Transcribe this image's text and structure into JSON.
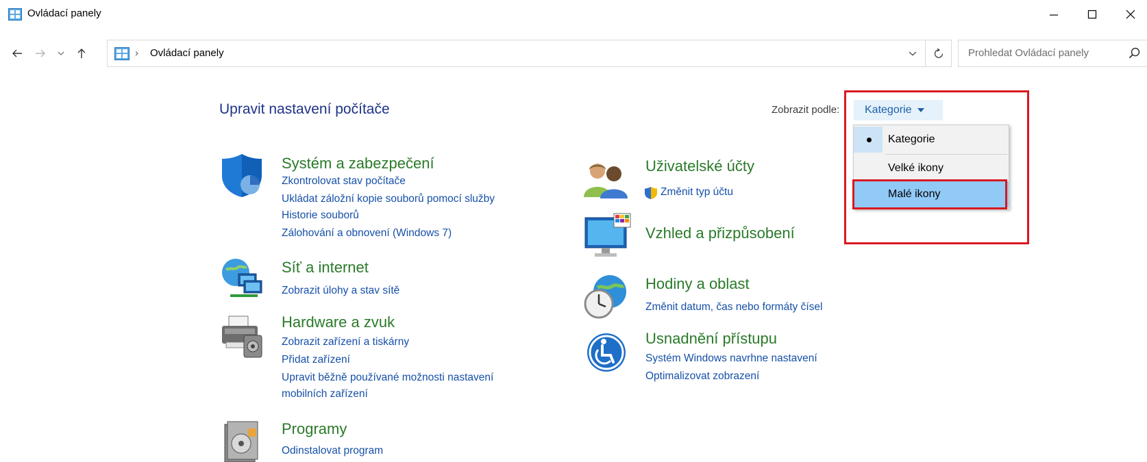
{
  "window": {
    "title": "Ovládací panely",
    "controls": {
      "minimize": "minimize-icon",
      "maximize": "maximize-icon",
      "close": "close-icon"
    }
  },
  "nav": {
    "breadcrumb": "Ovládací panely",
    "search_placeholder": "Prohledat Ovládací panely"
  },
  "main": {
    "heading": "Upravit nastavení počítače",
    "view_by_label": "Zobrazit podle:",
    "view_by_value": "Kategorie",
    "view_by_options": [
      "Kategorie",
      "Velké ikony",
      "Malé ikony"
    ],
    "selected_option": "Kategorie",
    "hovered_option": "Malé ikony"
  },
  "categories_left": [
    {
      "title": "Systém a zabezpečení",
      "icon": "shield-icon",
      "links": [
        "Zkontrolovat stav počítače",
        "Ukládat záložní kopie souborů pomocí služby",
        "Historie souborů",
        "Zálohování a obnovení (Windows 7)"
      ]
    },
    {
      "title": "Síť a internet",
      "icon": "network-icon",
      "links": [
        "Zobrazit úlohy a stav sítě"
      ]
    },
    {
      "title": "Hardware a zvuk",
      "icon": "printer-icon",
      "links": [
        "Zobrazit zařízení a tiskárny",
        "Přidat zařízení",
        "Upravit běžně používané možnosti nastavení",
        "mobilních zařízení"
      ]
    },
    {
      "title": "Programy",
      "icon": "programs-icon",
      "links": [
        "Odinstalovat program"
      ]
    }
  ],
  "categories_right": [
    {
      "title": "Uživatelské účty",
      "icon": "users-icon",
      "links": [
        "Změnit typ účtu"
      ]
    },
    {
      "title": "Vzhled a přizpůsobení",
      "icon": "monitor-icon",
      "links": []
    },
    {
      "title": "Hodiny a oblast",
      "icon": "clock-globe-icon",
      "links": [
        "Změnit datum, čas nebo formáty čísel"
      ]
    },
    {
      "title": "Usnadnění přístupu",
      "icon": "accessibility-icon",
      "links": [
        "Systém Windows navrhne nastavení",
        "Optimalizovat zobrazení"
      ]
    }
  ]
}
